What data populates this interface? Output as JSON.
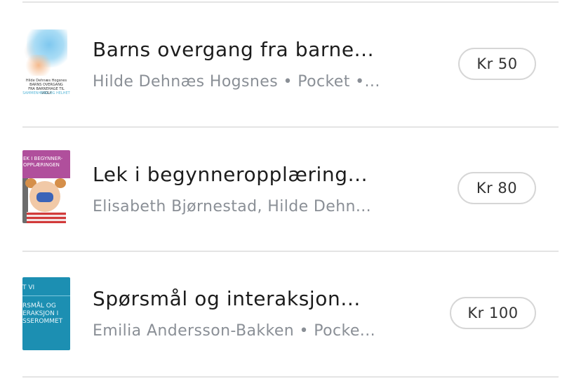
{
  "books": [
    {
      "title": "Barns overgang fra barne...",
      "meta": "Hilde Dehnæs Hogsnes • Pocket •...",
      "price": "Kr 50",
      "cover": {
        "line1": "Hilde Dehnæs Hogsnes",
        "line2": "BARNS OVERGANG",
        "line3": "FRA BARNEHAGE TIL SKOLE",
        "line4": "SAMMENHENG OG HELHET"
      }
    },
    {
      "title": "Lek i begynneropplæring...",
      "meta": "Elisabeth Bjørnestad, Hilde Dehn...",
      "price": "Kr 80",
      "cover": {
        "line1": "EK I BEGYNNER-",
        "line2": "OPPLÆRINGEN"
      }
    },
    {
      "title": "Spørsmål og interaksjon...",
      "meta": "Emilia Andersson-Bakken • Pocke...",
      "price": "Kr 100",
      "cover": {
        "line1": "T VI",
        "line2": "RSMÅL OG",
        "line3": "ERAKSJON I",
        "line4": "SSEROMMET"
      }
    }
  ],
  "colors": {
    "divider": "#e4e4e4",
    "title": "#1c1c1c",
    "meta": "#8a8f96",
    "button_border": "#d6d6d6"
  }
}
